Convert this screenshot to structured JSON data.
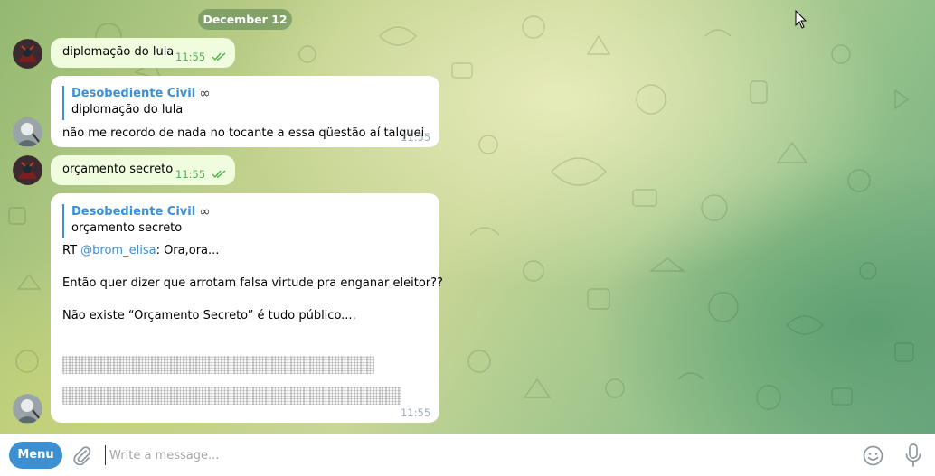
{
  "chat": {
    "date_label": "December 12",
    "messages": [
      {
        "text": "diplomação do lula",
        "time": "11:55"
      },
      {
        "reply_name": "Desobediente Civil",
        "reply_text": "diplomação do lula",
        "text": "não me recordo de nada no tocante a essa qüestão aí talquei",
        "time": "11:55"
      },
      {
        "text": "orçamento secreto",
        "time": "11:55"
      },
      {
        "reply_name": "Desobediente Civil",
        "reply_text": "orçamento secreto",
        "line1_prefix": "RT ",
        "line1_link": "@brom_elisa",
        "line1_suffix": ": Ora,ora...",
        "line2": "Então quer dizer que arrotam falsa virtude pra enganar eleitor??",
        "line3": "Não existe “Orçamento Secreto” é tudo público....",
        "time": "11:55"
      }
    ],
    "reply_name_icon": "infinity-icon"
  },
  "composer": {
    "menu_label": "Menu",
    "placeholder": "Write a message..."
  },
  "colors": {
    "accent": "#3c8fd0",
    "outgoing_bubble": "#effdde",
    "incoming_bubble": "#ffffff",
    "link": "#3a8fd6"
  }
}
